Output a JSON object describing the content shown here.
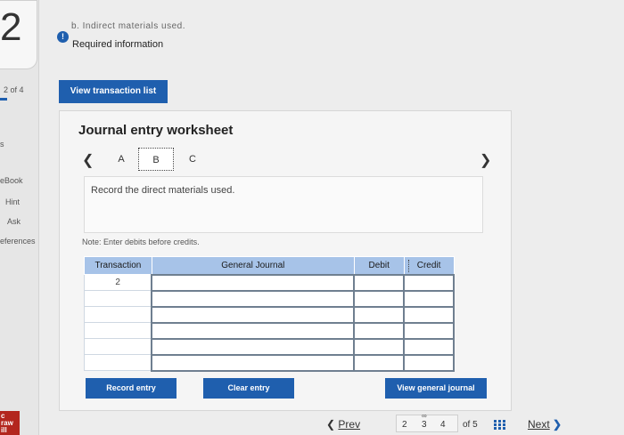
{
  "question": {
    "number": "2",
    "progress": "2 of 4"
  },
  "rail": {
    "items": [
      "s",
      "eBook",
      "Hint",
      "Ask",
      "eferences"
    ],
    "brand": "c\nraw\nill"
  },
  "header": {
    "crumb": "b. Indirect materials used.",
    "alert_icon": "!",
    "required_info": "Required information",
    "view_list_label": "View transaction list"
  },
  "worksheet": {
    "title": "Journal entry worksheet",
    "tabs": [
      "A",
      "B",
      "C"
    ],
    "selected_tab": "B",
    "instruction": "Record the direct materials used.",
    "note": "Note: Enter debits before credits.",
    "columns": [
      "Transaction",
      "General Journal",
      "Debit",
      "Credit"
    ],
    "rows": [
      {
        "transaction": "2",
        "account": "",
        "debit": "",
        "credit": ""
      },
      {
        "transaction": "",
        "account": "",
        "debit": "",
        "credit": ""
      },
      {
        "transaction": "",
        "account": "",
        "debit": "",
        "credit": ""
      },
      {
        "transaction": "",
        "account": "",
        "debit": "",
        "credit": ""
      },
      {
        "transaction": "",
        "account": "",
        "debit": "",
        "credit": ""
      },
      {
        "transaction": "",
        "account": "",
        "debit": "",
        "credit": ""
      }
    ],
    "buttons": {
      "record": "Record entry",
      "clear": "Clear entry",
      "view_journal": "View general journal"
    }
  },
  "footer": {
    "prev": "Prev",
    "pages": [
      "2",
      "3",
      "4"
    ],
    "of": "of 5",
    "next": "Next"
  },
  "colors": {
    "accent": "#1f5fae",
    "table_header": "#a7c3e8",
    "brand": "#b3261e"
  }
}
